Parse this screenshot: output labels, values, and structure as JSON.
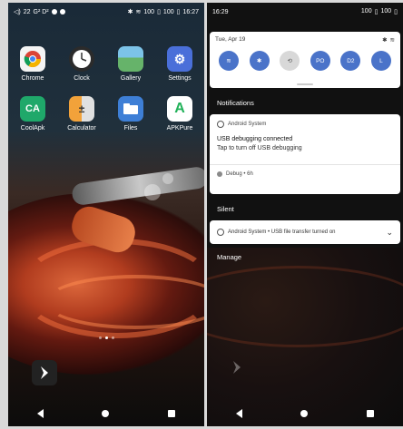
{
  "left": {
    "status": {
      "left_text": "22",
      "sim_text": "G² D²",
      "battery": "100",
      "time": "16:27"
    },
    "apps": [
      {
        "label": "Chrome",
        "icon": "chrome-icon",
        "bg": "#f4f4f4"
      },
      {
        "label": "Clock",
        "icon": "clock-icon",
        "bg": "#2b2b2b"
      },
      {
        "label": "Gallery",
        "icon": "gallery-icon",
        "bg": "#66b36a"
      },
      {
        "label": "Settings",
        "icon": "settings-icon",
        "bg": "#4a6fd9"
      },
      {
        "label": "CoolApk",
        "icon": "coolapk-icon",
        "bg": "#1fa86a"
      },
      {
        "label": "Calculator",
        "icon": "calculator-icon",
        "bg": "#f2a23a"
      },
      {
        "label": "Files",
        "icon": "files-icon",
        "bg": "#3e7fd6"
      },
      {
        "label": "APKPure",
        "icon": "apkpure-icon",
        "bg": "#ffffff"
      }
    ]
  },
  "right": {
    "status": {
      "time": "16:29",
      "battery": "100"
    },
    "qs": {
      "date": "Tue, Apr 19",
      "tiles": [
        {
          "label": "",
          "icon": "wifi-icon"
        },
        {
          "label": "",
          "icon": "bluetooth-icon"
        },
        {
          "label": "",
          "icon": "auto-rotate-icon"
        },
        {
          "label": "PO",
          "icon": ""
        },
        {
          "label": "D2",
          "icon": ""
        },
        {
          "label": "L",
          "icon": ""
        }
      ]
    },
    "notifications_header": "Notifications",
    "notification": {
      "app": "Android System",
      "title": "USB debugging connected",
      "body": "Tap to turn off USB debugging",
      "footer": "Debug • 6h"
    },
    "silent_header": "Silent",
    "silent_item": "Android System • USB file transfer turned on",
    "manage": "Manage"
  }
}
